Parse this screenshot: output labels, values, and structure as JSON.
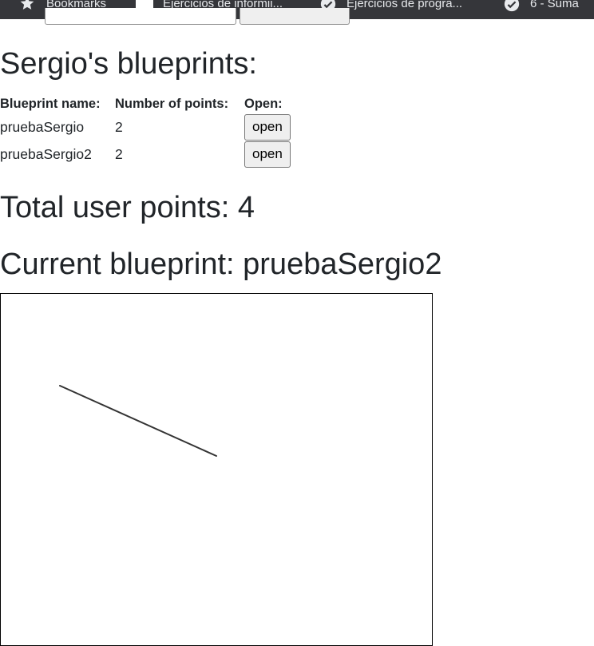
{
  "bookmarks_bar": {
    "items": [
      {
        "label": "Bookmarks",
        "icon": "star-icon"
      },
      {
        "label": "Ejercicios de informii...",
        "icon": "folder-icon"
      },
      {
        "label": "Ejercicios de progra...",
        "icon": "globe-icon"
      },
      {
        "label": "6 - Suma",
        "icon": "globe-icon"
      }
    ]
  },
  "page": {
    "title": "Sergio's blueprints:",
    "total_points_label": "Total user points: 4",
    "current_blueprint_label": "Current blueprint: pruebaSergio2"
  },
  "table": {
    "headers": [
      "Blueprint name:",
      "Number of points:",
      "Open:"
    ],
    "rows": [
      {
        "name": "pruebaSergio",
        "points": "2",
        "action": "open"
      },
      {
        "name": "pruebaSergio2",
        "points": "2",
        "action": "open"
      }
    ]
  },
  "colors": {
    "bookmarks_bg": "#35363a",
    "text": "#212529",
    "stroke": "#333333"
  }
}
